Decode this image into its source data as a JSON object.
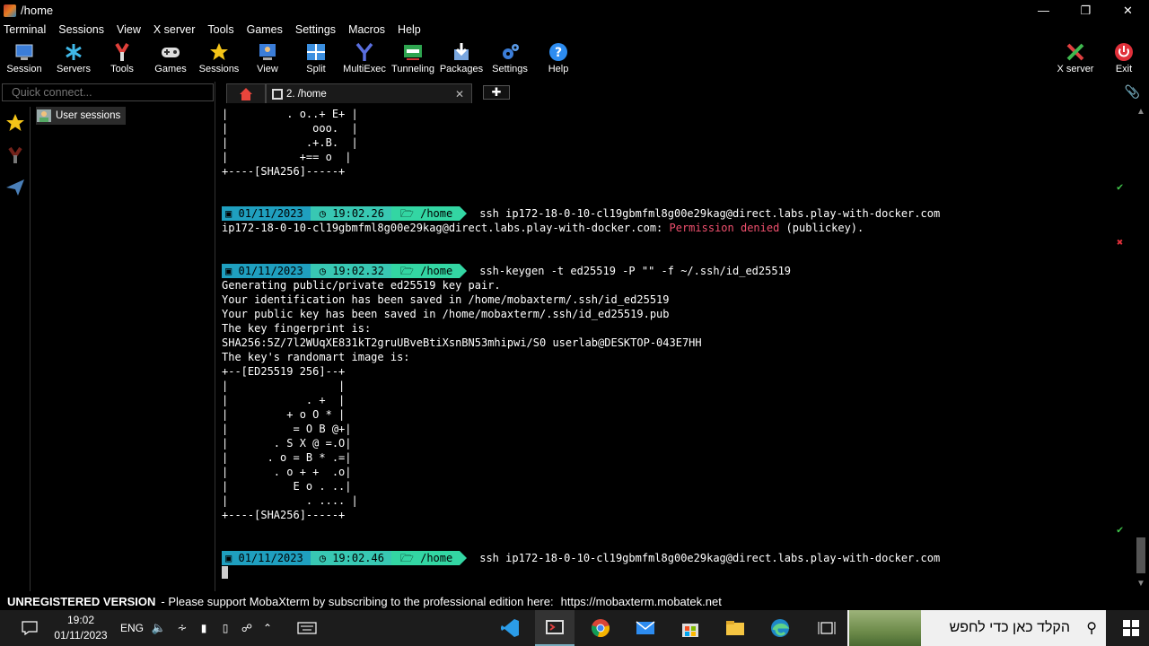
{
  "window": {
    "title": "/home",
    "minimize": "—",
    "restore": "❐",
    "close": "✕"
  },
  "menu": [
    "Terminal",
    "Sessions",
    "View",
    "X server",
    "Tools",
    "Games",
    "Settings",
    "Macros",
    "Help"
  ],
  "toolbar": {
    "items": [
      {
        "label": "Session",
        "icon": "session-icon"
      },
      {
        "label": "Servers",
        "icon": "servers-icon"
      },
      {
        "label": "Tools",
        "icon": "tools-icon"
      },
      {
        "label": "Games",
        "icon": "games-icon"
      },
      {
        "label": "Sessions",
        "icon": "star-icon"
      },
      {
        "label": "View",
        "icon": "view-icon"
      },
      {
        "label": "Split",
        "icon": "split-icon"
      },
      {
        "label": "MultiExec",
        "icon": "multiexec-icon"
      },
      {
        "label": "Tunneling",
        "icon": "tunneling-icon"
      },
      {
        "label": "Packages",
        "icon": "packages-icon"
      },
      {
        "label": "Settings",
        "icon": "gear-icon"
      },
      {
        "label": "Help",
        "icon": "help-icon"
      }
    ],
    "xserver": "X server",
    "exit": "Exit"
  },
  "sidebar": {
    "quick_connect_placeholder": "Quick connect...",
    "user_sessions": "User sessions"
  },
  "tabs": {
    "terminal_tab": "2. /home",
    "close": "✕",
    "new_tab": "✚"
  },
  "terminal": {
    "art1": [
      "|         . o..+ E+ |",
      "|             ooo.  |",
      "|            .+.B.  |",
      "|           +== o  |",
      "+----[SHA256]-----+"
    ],
    "prompt1": {
      "date": "01/11/2023",
      "time": "19:02.26",
      "dir": "/home",
      "cmd": "ssh ip172-18-0-10-cl19gbmfml8g00e29kag@direct.labs.play-with-docker.com"
    },
    "out1_a": "ip172-18-0-10-cl19gbmfml8g00e29kag@direct.labs.play-with-docker.com: ",
    "out1_b": "Permission denied",
    "out1_c": " (publickey).",
    "prompt2": {
      "date": "01/11/2023",
      "time": "19:02.32",
      "dir": "/home",
      "cmd": "ssh-keygen -t ed25519 -P \"\" -f ~/.ssh/id_ed25519"
    },
    "out2": [
      "Generating public/private ed25519 key pair.",
      "Your identification has been saved in /home/mobaxterm/.ssh/id_ed25519",
      "Your public key has been saved in /home/mobaxterm/.ssh/id_ed25519.pub",
      "The key fingerprint is:",
      "SHA256:5Z/7l2WUqXE831kT2gruUBveBtiXsnBN53mhipwi/S0 userlab@DESKTOP-043E7HH",
      "The key's randomart image is:",
      "+--[ED25519 256]--+",
      "|                 |",
      "|            . +  |",
      "|         + o O * |",
      "|          = O B @+|",
      "|       . S X @ =.O|",
      "|      . o = B * .=|",
      "|       . o + +  .o|",
      "|          E o . ..|",
      "|            . .... |",
      "+----[SHA256]-----+"
    ],
    "prompt3": {
      "date": "01/11/2023",
      "time": "19:02.46",
      "dir": "/home",
      "cmd": "ssh ip172-18-0-10-cl19gbmfml8g00e29kag@direct.labs.play-with-docker.com"
    },
    "check": "✔",
    "cross": "✖"
  },
  "statusbar": {
    "unregistered": "UNREGISTERED VERSION",
    "message": "-  Please support MobaXterm by subscribing to the professional edition here:",
    "link": "https://mobaxterm.mobatek.net"
  },
  "taskbar": {
    "lang": "ENG",
    "time": "19:02",
    "date": "01/11/2023",
    "search_text": "הקלד כאן כדי לחפש"
  },
  "colors": {
    "prompt_date": "#1f9fbf",
    "prompt_time": "#38c8b3",
    "prompt_dir": "#33d6a3",
    "error": "#f0506e"
  }
}
